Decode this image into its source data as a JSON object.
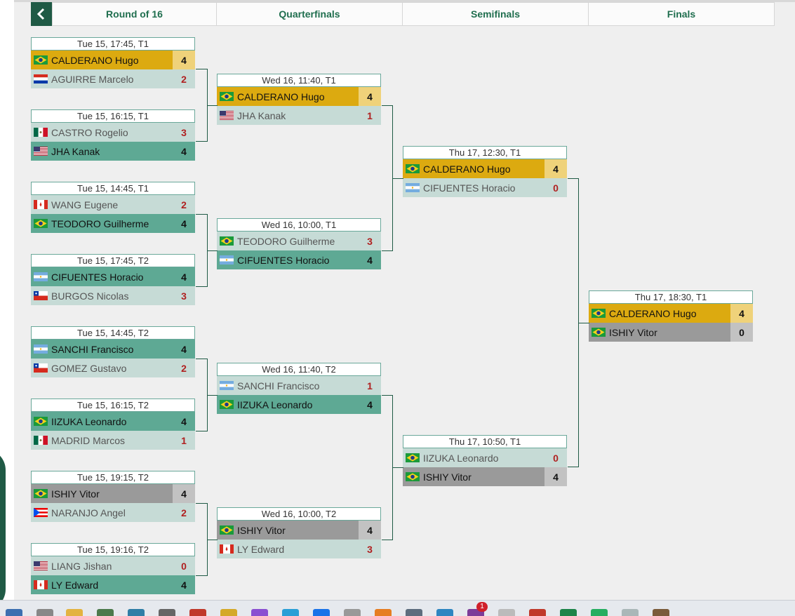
{
  "header": {
    "rounds": [
      "Round of 16",
      "Quarterfinals",
      "Semifinals",
      "Finals"
    ]
  },
  "colors": {
    "accent": "#1f5a45",
    "winner_row": "#5ea994",
    "loser_row": "#c6dbd6",
    "champion_row": "#dcaa10",
    "win_score": "#2c7a2c",
    "lose_score": "#b02020"
  },
  "matches": [
    {
      "time": "Tue 15, 17:45, T1",
      "p1": {
        "flag": "BRA",
        "name": "CALDERANO Hugo",
        "score": "4"
      },
      "p2": {
        "flag": "PAR",
        "name": "AGUIRRE Marcelo",
        "score": "2"
      }
    },
    {
      "time": "Tue 15, 16:15, T1",
      "p1": {
        "flag": "MEX",
        "name": "CASTRO Rogelio",
        "score": "3"
      },
      "p2": {
        "flag": "USA",
        "name": "JHA Kanak",
        "score": "4"
      }
    },
    {
      "time": "Tue 15, 14:45, T1",
      "p1": {
        "flag": "CAN",
        "name": "WANG Eugene",
        "score": "2"
      },
      "p2": {
        "flag": "BRA",
        "name": "TEODORO Guilherme",
        "score": "4"
      }
    },
    {
      "time": "Tue 15, 17:45, T2",
      "p1": {
        "flag": "ARG",
        "name": "CIFUENTES Horacio",
        "score": "4"
      },
      "p2": {
        "flag": "CHI",
        "name": "BURGOS Nicolas",
        "score": "3"
      }
    },
    {
      "time": "Tue 15, 14:45, T2",
      "p1": {
        "flag": "ARG",
        "name": "SANCHI Francisco",
        "score": "4"
      },
      "p2": {
        "flag": "CHI",
        "name": "GOMEZ Gustavo",
        "score": "2"
      }
    },
    {
      "time": "Tue 15, 16:15, T2",
      "p1": {
        "flag": "BRA",
        "name": "IIZUKA Leonardo",
        "score": "4"
      },
      "p2": {
        "flag": "MEX",
        "name": "MADRID Marcos",
        "score": "1"
      }
    },
    {
      "time": "Tue 15, 19:15, T2",
      "p1": {
        "flag": "BRA",
        "name": "ISHIY Vitor",
        "score": "4"
      },
      "p2": {
        "flag": "PUR",
        "name": "NARANJO Angel",
        "score": "2"
      }
    },
    {
      "time": "Tue 15, 19:16, T2",
      "p1": {
        "flag": "USA",
        "name": "LIANG Jishan",
        "score": "0"
      },
      "p2": {
        "flag": "CAN",
        "name": "LY Edward",
        "score": "4"
      }
    },
    {
      "time": "Wed 16, 11:40, T1",
      "p1": {
        "flag": "BRA",
        "name": "CALDERANO Hugo",
        "score": "4"
      },
      "p2": {
        "flag": "USA",
        "name": "JHA Kanak",
        "score": "1"
      }
    },
    {
      "time": "Wed 16, 10:00, T1",
      "p1": {
        "flag": "BRA",
        "name": "TEODORO Guilherme",
        "score": "3"
      },
      "p2": {
        "flag": "ARG",
        "name": "CIFUENTES Horacio",
        "score": "4"
      }
    },
    {
      "time": "Wed 16, 11:40, T2",
      "p1": {
        "flag": "ARG",
        "name": "SANCHI Francisco",
        "score": "1"
      },
      "p2": {
        "flag": "BRA",
        "name": "IIZUKA Leonardo",
        "score": "4"
      }
    },
    {
      "time": "Wed 16, 10:00, T2",
      "p1": {
        "flag": "BRA",
        "name": "ISHIY Vitor",
        "score": "4"
      },
      "p2": {
        "flag": "CAN",
        "name": "LY Edward",
        "score": "3"
      }
    },
    {
      "time": "Thu 17, 12:30, T1",
      "p1": {
        "flag": "BRA",
        "name": "CALDERANO Hugo",
        "score": "4"
      },
      "p2": {
        "flag": "ARG",
        "name": "CIFUENTES Horacio",
        "score": "0"
      }
    },
    {
      "time": "Thu 17, 10:50, T1",
      "p1": {
        "flag": "BRA",
        "name": "IIZUKA Leonardo",
        "score": "0"
      },
      "p2": {
        "flag": "BRA",
        "name": "ISHIY Vitor",
        "score": "4"
      }
    },
    {
      "time": "Thu 17, 18:30, T1",
      "p1": {
        "flag": "BRA",
        "name": "CALDERANO Hugo",
        "score": "4"
      },
      "p2": {
        "flag": "BRA",
        "name": "ISHIY Vitor",
        "score": "0"
      }
    }
  ],
  "taskbar": {
    "notification_badge": "1"
  }
}
